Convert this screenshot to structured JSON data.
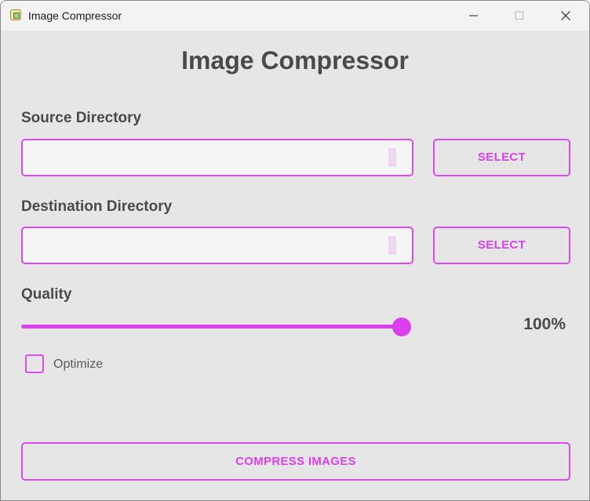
{
  "window": {
    "title": "Image Compressor",
    "app_icon": "app-icon"
  },
  "titlebar_controls": {
    "minimize_icon": "minimize-icon",
    "maximize_icon": "maximize-icon",
    "close_icon": "close-icon"
  },
  "main": {
    "heading": "Image Compressor",
    "source": {
      "label": "Source Directory",
      "value": "",
      "placeholder": "",
      "select_label": "SELECT"
    },
    "destination": {
      "label": "Destination Directory",
      "value": "",
      "placeholder": "",
      "select_label": "SELECT"
    },
    "quality": {
      "label": "Quality",
      "value": 100,
      "display": "100%"
    },
    "optimize": {
      "label": "Optimize",
      "checked": false
    },
    "compress_label": "COMPRESS IMAGES"
  },
  "colors": {
    "accent": "#dc3fee",
    "background": "#e6e6e6",
    "text": "#4a4a4a"
  }
}
